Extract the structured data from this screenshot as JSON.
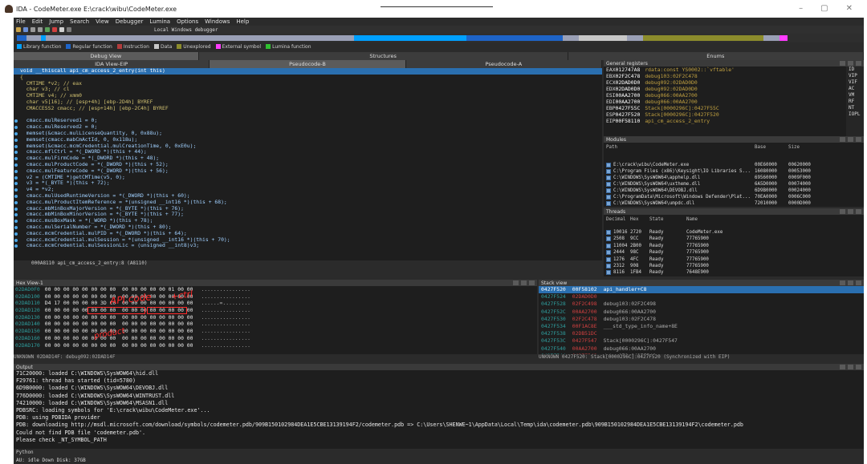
{
  "window": {
    "title": "IDA - CodeMeter.exe E:\\crack\\wibu\\CodeMeter.exe",
    "min": "–",
    "max": "▢",
    "close": "✕"
  },
  "menu": [
    "File",
    "Edit",
    "Jump",
    "Search",
    "View",
    "Debugger",
    "Lumina",
    "Options",
    "Windows",
    "Help"
  ],
  "toolbar": {
    "debugger_label": "Local Windows debugger"
  },
  "legend": [
    {
      "label": "Library function",
      "color": "#00a0ff"
    },
    {
      "label": "Regular function",
      "color": "#1e64c8"
    },
    {
      "label": "Instruction",
      "color": "#b23c3c"
    },
    {
      "label": "Data",
      "color": "#c8c8c8"
    },
    {
      "label": "Unexplored",
      "color": "#8c8c2c"
    },
    {
      "label": "External symbol",
      "color": "#ff3cff"
    },
    {
      "label": "Lumina function",
      "color": "#30c030"
    }
  ],
  "tabs_left": [
    {
      "label": "Debug View",
      "active": true
    },
    {
      "label": "Structures",
      "active": false
    },
    {
      "label": "Enums",
      "active": false
    }
  ],
  "tabs_sub": [
    {
      "label": "IDA View-EIP"
    },
    {
      "label": "Pseudocode-B"
    },
    {
      "label": "Pseudocode-A"
    }
  ],
  "pseudocode": {
    "lines": [
      {
        "text": "void __thiscall api_cm_access_2_entry(int this)",
        "dot": false,
        "hl": true
      },
      {
        "text": "{",
        "dot": false
      },
      {
        "text": "  CMTIME *v2; // eax",
        "dot": false
      },
      {
        "text": "  char v3; // cl",
        "dot": false
      },
      {
        "text": "  CMTIME v4; // xmm0",
        "dot": false
      },
      {
        "text": "  char v5[16]; // [esp+4h] [ebp-2D4h] BYREF",
        "dot": false
      },
      {
        "text": "  CMACCESS2 cmacc; // [esp+14h] [ebp-2C4h] BYREF",
        "dot": false
      },
      {
        "text": "",
        "dot": false
      },
      {
        "text": "  cmacc.mulReserved1 = 0;",
        "dot": true
      },
      {
        "text": "  cmacc.mulReserved2 = 0;",
        "dot": true
      },
      {
        "text": "  memset(&cmacc.mulLicenseQuantity, 0, 0x88u);",
        "dot": true
      },
      {
        "text": "  memset(cmacc.mabCmActId, 0, 0x118u);",
        "dot": true
      },
      {
        "text": "  memset(&cmacc.mcmCredential.mulCreationTime, 0, 0xE0u);",
        "dot": true
      },
      {
        "text": "  cmacc.mflCtrl = *(_DWORD *)(this + 44);",
        "dot": true
      },
      {
        "text": "  cmacc.mulFirmCode = *(_DWORD *)(this + 48);",
        "dot": true
      },
      {
        "text": "  cmacc.mulProductCode = *(_DWORD *)(this + 52);",
        "dot": true
      },
      {
        "text": "  cmacc.mulFeatureCode = *(_DWORD *)(this + 56);",
        "dot": true
      },
      {
        "text": "  v2 = (CMTIME *)getCMTime(v5, 0);",
        "dot": true
      },
      {
        "text": "  v3 = *(_BYTE *)(this + 72);",
        "dot": true
      },
      {
        "text": "  v4 = *v2;",
        "dot": true
      },
      {
        "text": "  cmacc.mulUsedRuntimeVersion = *(_DWORD *)(this + 60);",
        "dot": true
      },
      {
        "text": "  cmacc.mulProductItemReference = *(unsigned __int16 *)(this + 68);",
        "dot": true
      },
      {
        "text": "  cmacc.mbMinBoxMajorVersion = *(_BYTE *)(this + 76);",
        "dot": true
      },
      {
        "text": "  cmacc.mbMinBoxMinorVersion = *(_BYTE *)(this + 77);",
        "dot": true
      },
      {
        "text": "  cmacc.musBoxMask = *(_WORD *)(this + 78);",
        "dot": true
      },
      {
        "text": "  cmacc.mulSerialNumber = *(_DWORD *)(this + 80);",
        "dot": true
      },
      {
        "text": "  cmacc.mcmCredential.mulPID = *(_DWORD *)(this + 64);",
        "dot": true
      },
      {
        "text": "  cmacc.mcmCredential.mulSession = *(unsigned __int16 *)(this + 70);",
        "dot": true
      },
      {
        "text": "  cmacc.mcmCredential.mulSessionLic = (unsigned __int8)v3;",
        "dot": true
      }
    ],
    "status": "000A8110 api_cm_access_2_entry:8 (A8110)"
  },
  "hex": {
    "title": "Hex View-1",
    "rows": [
      {
        "addr": "02DAD0F0",
        "bytes": "00 00 00 00 00 00 00 00  00 00 00 00 00 01 00 00",
        "ascii": "................"
      },
      {
        "addr": "02DAD100",
        "bytes": "00 00 00 00 00 00 00 00  00 00 00 00 00 00 00 00",
        "ascii": "................"
      },
      {
        "addr": "02DAD110",
        "bytes": "D4 17 00 00 00 00 3D C0  00 00 00 00 00 00 00 00",
        "ascii": "......=........."
      },
      {
        "addr": "02DAD120",
        "bytes": "00 00 00 00 00 00 00 00  00 00 00 00 00 00 00 00",
        "ascii": "................"
      },
      {
        "addr": "02DAD130",
        "bytes": "00 00 00 00 00 00 00 00  00 00 00 00 00 00 00 00",
        "ascii": "................"
      },
      {
        "addr": "02DAD140",
        "bytes": "00 00 00 00 00 00 00 00  00 00 00 00 00 00 00 00",
        "ascii": "................"
      },
      {
        "addr": "02DAD150",
        "bytes": "00 00 00 00 00 00 00 00  00 00 00 00 00 00 00 00",
        "ascii": "................"
      },
      {
        "addr": "02DAD160",
        "bytes": "00 00 00 00 00 00 00 00  00 00 00 00 00 00 00 00",
        "ascii": "................"
      },
      {
        "addr": "02DAD170",
        "bytes": "00 00 00 00 00 00 00 00  00 00 00 00 00 00 00 00",
        "ascii": "................"
      }
    ],
    "status": "UNKNOWN 02DAD14F: debug092:02DAD14F",
    "annotations": {
      "top": "API code",
      "top2": "+ctrl",
      "mid": "product"
    }
  },
  "registers": {
    "title": "General registers",
    "rows": [
      {
        "name": "EAX",
        "val": "012747A8",
        "desc": "rdata:const YS0002::`vftable'"
      },
      {
        "name": "EBX",
        "val": "02F2C478",
        "desc": "debug103:02F2C478"
      },
      {
        "name": "ECX",
        "val": "02DAD0D0",
        "desc": "debug092:02DAD0D0"
      },
      {
        "name": "EDX",
        "val": "02DAD0D0",
        "desc": "debug092:02DAD0D0"
      },
      {
        "name": "ESI",
        "val": "00AA2700",
        "desc": "debug066:00AA2700"
      },
      {
        "name": "EDI",
        "val": "00AA2700",
        "desc": "debug066:00AA2700"
      },
      {
        "name": "EBP",
        "val": "0427F55C",
        "desc": "Stack[0000296C]:0427F55C"
      },
      {
        "name": "ESP",
        "val": "0427F520",
        "desc": "Stack[0000296C]:0427F520"
      },
      {
        "name": "EIP",
        "val": "00F58110",
        "desc": "api_cm_access_2_entry"
      }
    ],
    "flags": [
      "ID",
      "VIP",
      "VIF",
      "AC",
      "VM",
      "RF",
      "NT",
      "IOPL"
    ]
  },
  "modules": {
    "title": "Modules",
    "headers": [
      "Path",
      "Base",
      "Size"
    ],
    "rows": [
      {
        "path": "E:\\crack\\wibu\\CodeMeter.exe",
        "base": "00E60000",
        "size": "00620000"
      },
      {
        "path": "C:\\Program Files (x86)\\Keysight\\IO Libraries S...",
        "base": "16080000",
        "size": "00053000"
      },
      {
        "path": "C:\\WINDOWS\\SysWOW64\\apphelp.dll",
        "base": "69560000",
        "size": "0009F000"
      },
      {
        "path": "C:\\WINDOWS\\SysWOW64\\uxtheme.dll",
        "base": "6A5D0000",
        "size": "00074000"
      },
      {
        "path": "C:\\WINDOWS\\SysWOW64\\DEVOBJ.dll",
        "base": "6D9B0000",
        "size": "00024000"
      },
      {
        "path": "C:\\ProgramData\\Microsoft\\Windows Defender\\Plat...",
        "base": "70EA0000",
        "size": "0006C000"
      },
      {
        "path": "C:\\WINDOWS\\SysWOW64\\umpdc.dll",
        "base": "72010000",
        "size": "0000D000"
      }
    ]
  },
  "threads": {
    "title": "Threads",
    "headers": [
      "Decimal",
      "Hex",
      "State",
      "Name"
    ],
    "rows": [
      {
        "dec": "10016",
        "hex": "2720",
        "state": "Ready",
        "name": "CodeMeter.exe"
      },
      {
        "dec": "2508",
        "hex": "9CC",
        "state": "Ready",
        "name": "77765900"
      },
      {
        "dec": "11004",
        "hex": "2B00",
        "state": "Ready",
        "name": "77765900"
      },
      {
        "dec": "2444",
        "hex": "98C",
        "state": "Ready",
        "name": "77765900"
      },
      {
        "dec": "1276",
        "hex": "4FC",
        "state": "Ready",
        "name": "77765900"
      },
      {
        "dec": "2312",
        "hex": "908",
        "state": "Ready",
        "name": "77765900"
      },
      {
        "dec": "8116",
        "hex": "1FB4",
        "state": "Ready",
        "name": "7648E900"
      },
      {
        "dec": "2300",
        "hex": "8FC",
        "state": "Ready",
        "name": "7648E900"
      }
    ]
  },
  "stack": {
    "title": "Stack view",
    "rows": [
      {
        "addr": "0427F520",
        "val": "00F58102",
        "desc": "api_handler+C8",
        "hl": true
      },
      {
        "addr": "0427F524",
        "val": "02DAD0D0",
        "desc": ""
      },
      {
        "addr": "0427F528",
        "val": "02F2C498",
        "desc": "debug103:02F2C498"
      },
      {
        "addr": "0427F52C",
        "val": "00AA2700",
        "desc": "debug066:00AA2700"
      },
      {
        "addr": "0427F530",
        "val": "02F2C478",
        "desc": "debug103:02F2C478"
      },
      {
        "addr": "0427F534",
        "val": "00F1AC8E",
        "desc": "___std_type_info_name+8E"
      },
      {
        "addr": "0427F538",
        "val": "02DB51DC",
        "desc": ""
      },
      {
        "addr": "0427F53C",
        "val": "0427F547",
        "desc": "Stack[0000296C]:0427F547"
      },
      {
        "addr": "0427F540",
        "val": "00AA2700",
        "desc": "debug066:00AA2700"
      },
      {
        "addr": "0427F544",
        "val": "0427F548",
        "desc": "debug079:0427F548"
      }
    ],
    "status": "UNKNOWN 0427F520: Stack[0000296C]:0427F520 (Synchronized with EIP)"
  },
  "output": {
    "title": "Output",
    "lines": [
      "71C20000: loaded C:\\WINDOWS\\SysWOW64\\hid.dll",
      "F29761: thread has started (tid=5780)",
      "6D9B0000: loaded C:\\WINDOWS\\SysWOW64\\DEVOBJ.dll",
      "776D0000: loaded C:\\WINDOWS\\SysWOW64\\WINTRUST.dll",
      "74210000: loaded C:\\WINDOWS\\SysWOW64\\MSASN1.dll",
      "PDBSRC: loading symbols for 'E:\\crack\\wibu\\CodeMeter.exe'...",
      "PDB: using PDBIDA provider",
      "PDB: downloading http://msdl.microsoft.com/download/symbols/codemeter.pdb/909B150102984DEA1E5CBE13139194F2/codemeter.pdb => C:\\Users\\SHENWE~1\\AppData\\Local\\Temp\\ida\\codemeter.pdb\\909B150102984DEA1E5CBE13139194F2\\codemeter.pdb",
      "Could not find PDB file 'codemeter.pdb'.",
      "Please check _NT_SYMBOL_PATH"
    ],
    "lang": "Python"
  },
  "statusbar": "AU:  idle   Down   Disk: 37GB"
}
